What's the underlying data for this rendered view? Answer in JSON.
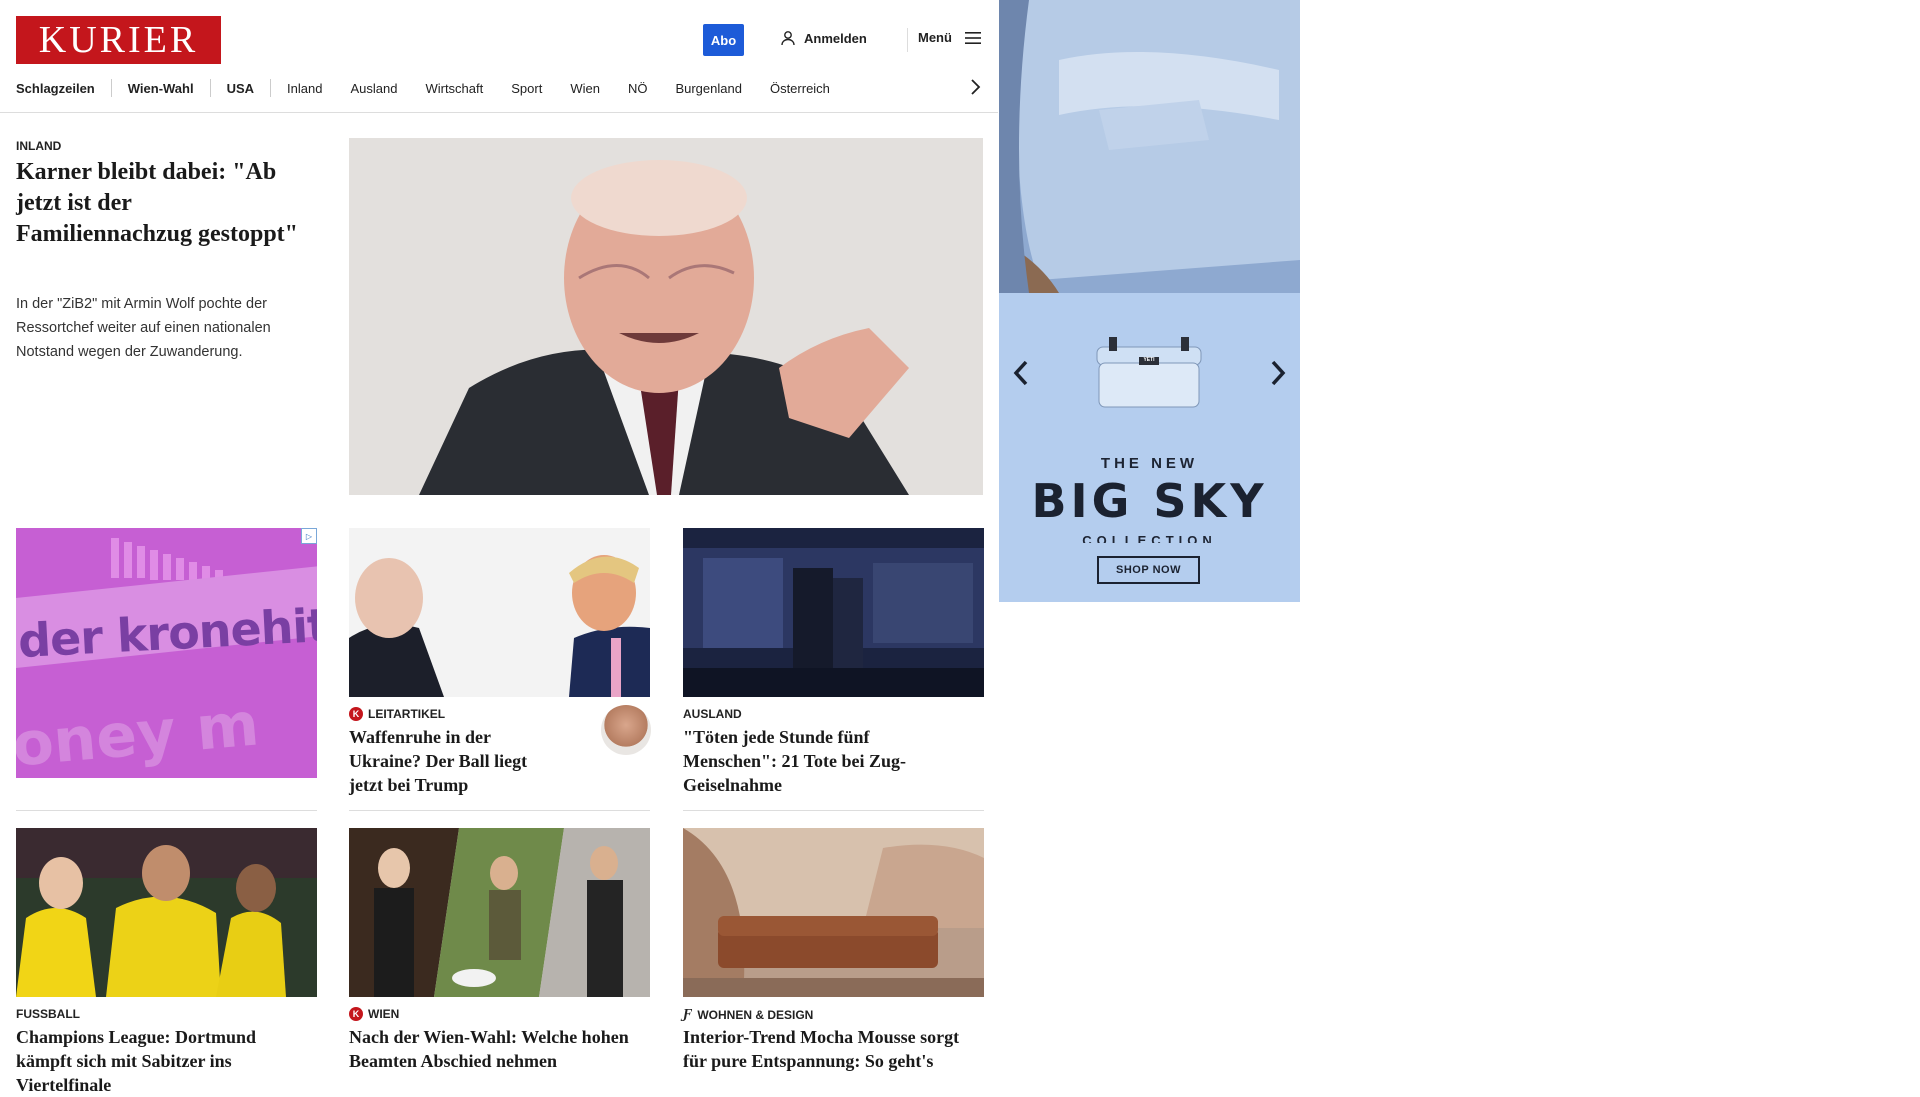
{
  "header": {
    "logo_text": "KURIER",
    "abo_label": "Abo",
    "login_label": "Anmelden",
    "menu_label": "Menü",
    "login_icon": "user-icon",
    "menu_icon": "hamburger-icon",
    "colors": {
      "brand_red": "#c4161c",
      "abo_blue": "#1d5bd8"
    }
  },
  "nav": {
    "items": [
      "Schlagzeilen",
      "Wien-Wahl",
      "USA",
      "Inland",
      "Ausland",
      "Wirtschaft",
      "Sport",
      "Wien",
      "NÖ",
      "Burgenland",
      "Österreich"
    ],
    "more_icon": "chevron-right-icon"
  },
  "lead": {
    "kicker": "INLAND",
    "title": "Karner bleibt dabei: \"Ab jetzt ist der Familiennachzug gestoppt\"",
    "teaser": "In der \"ZiB2\" mit Armin Wolf pochte der Ressortchef weiter auf einen nationalen Notstand wegen der Zuwanderung."
  },
  "cards": [
    {
      "kicker": "LEITARTIKEL",
      "title": "Waffenruhe in der Ukraine? Der Ball liegt jetzt bei Trump",
      "icon": "kurier-k-icon",
      "author_avatar": true
    },
    {
      "kicker": "AUSLAND",
      "title": "\"Töten jede Stunde fünf Menschen\": 21 Tote bei Zug-Geiselnahme"
    },
    {
      "kicker": "FUSSBALL",
      "title": "Champions League: Dortmund kämpft sich mit Sabitzer ins Viertelfinale"
    },
    {
      "kicker": "WIEN",
      "title": "Nach der Wien-Wahl: Welche hohen Beamten Abschied nehmen",
      "icon": "kurier-k-icon"
    },
    {
      "kicker": "WOHNEN & DESIGN",
      "title": "Interior-Trend Mocha Mousse sorgt für pure Entspannung: So geht's",
      "icon": "design-f-icon"
    }
  ],
  "ads": {
    "kronehit_text": "der kronehit",
    "kronehit_sub": "oney m",
    "sky_new": "THE NEW",
    "sky_big": "BIG SKY",
    "sky_collection": "COLLECTION",
    "sky_cta": "SHOP NOW",
    "sky_brand": "YETI"
  }
}
